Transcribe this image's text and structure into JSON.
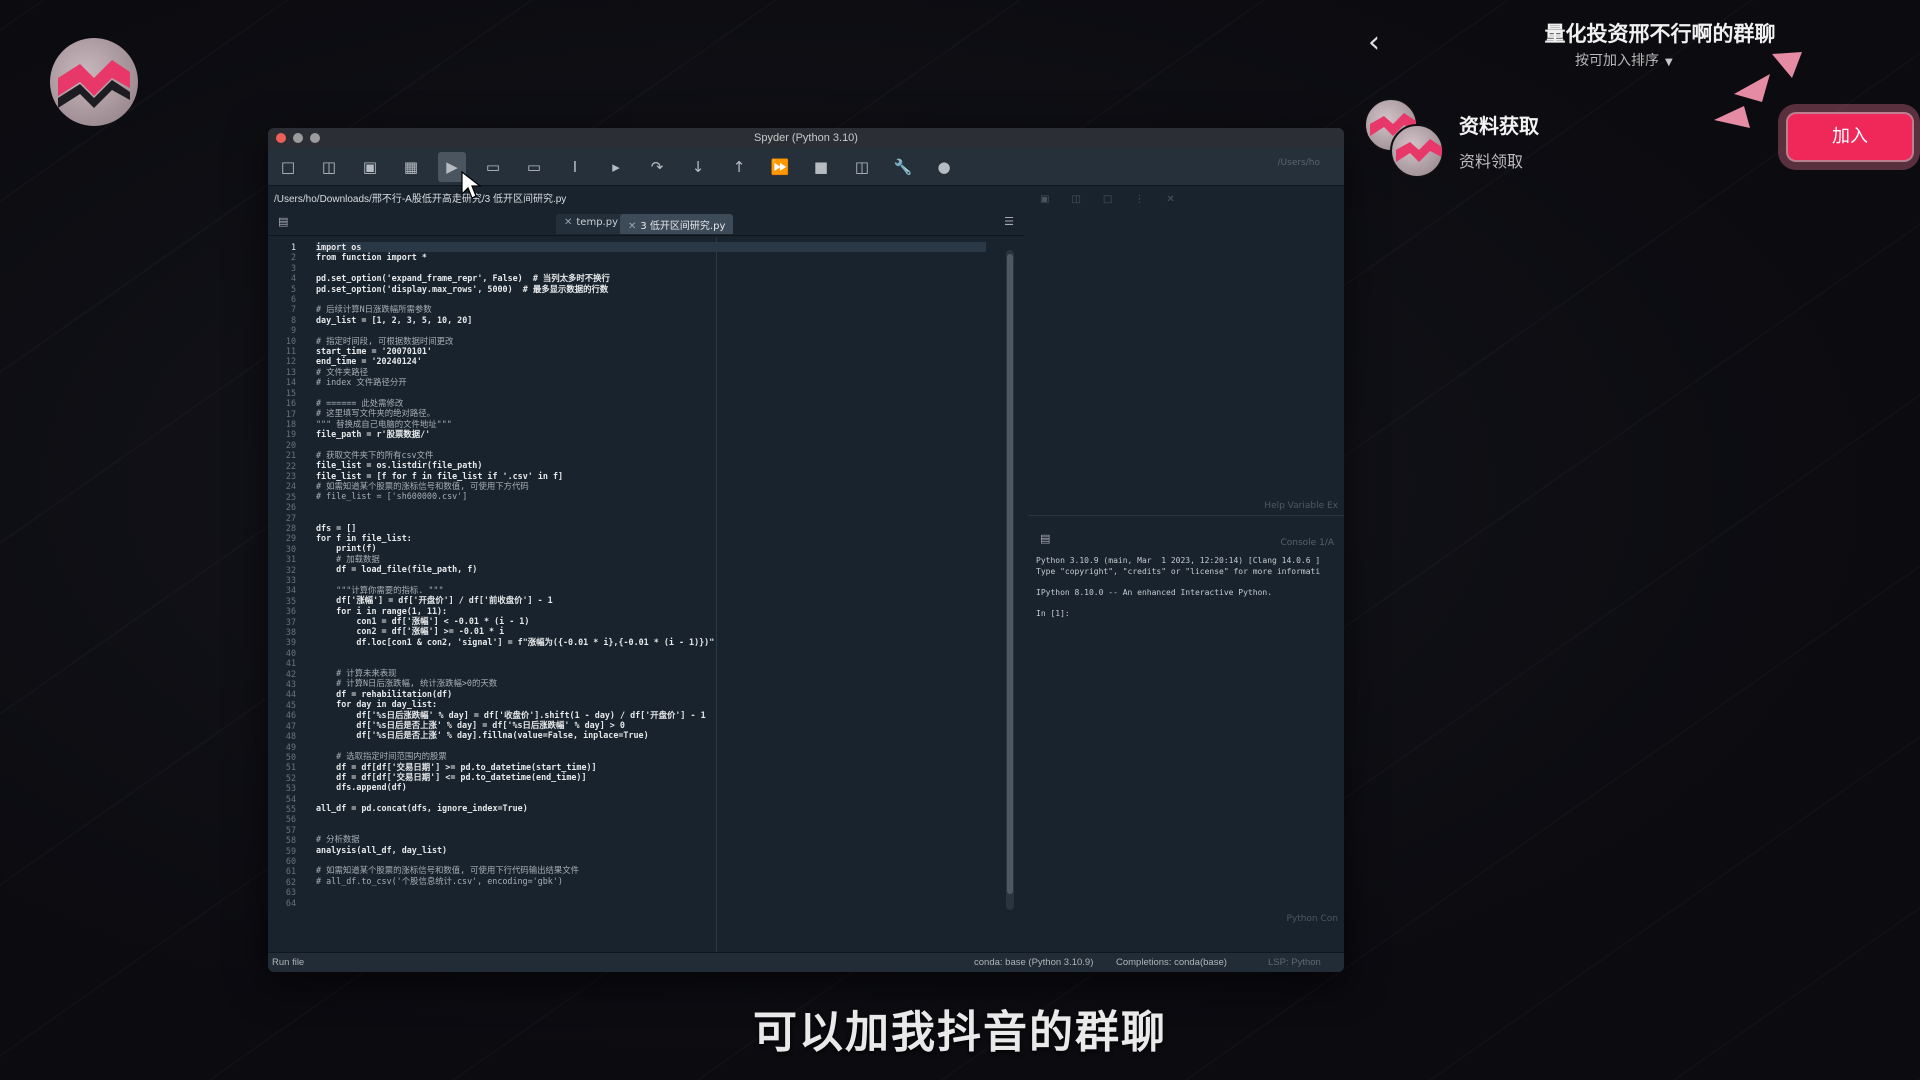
{
  "window": {
    "title": "Spyder (Python 3.10)",
    "path": "/Users/ho/Downloads/邢不行-A股低开高走研究/3 低开区间研究.py",
    "toolbar_path": "/Users/ho"
  },
  "editor": {
    "tabs": [
      {
        "label": "temp.py"
      },
      {
        "label": "3 低开区间研究.py"
      }
    ],
    "line_numbers": [
      "1",
      "2",
      "3",
      "4",
      "5",
      "6",
      "7",
      "8",
      "9",
      "10",
      "11",
      "12",
      "13",
      "14",
      "15",
      "16",
      "17",
      "18",
      "19",
      "20",
      "21",
      "22",
      "23",
      "24",
      "25",
      "26",
      "27",
      "28",
      "29",
      "30",
      "31",
      "32",
      "33",
      "34",
      "35",
      "36",
      "37",
      "38",
      "39",
      "40",
      "41",
      "42",
      "43",
      "44",
      "45",
      "46",
      "47",
      "48",
      "49",
      "50",
      "51",
      "52",
      "53",
      "54",
      "55",
      "56",
      "57",
      "58",
      "59",
      "60",
      "61",
      "62",
      "63",
      "64"
    ],
    "lines": [
      "import os",
      "from function import *",
      "",
      "pd.set_option('expand_frame_repr', False)  # 当列太多时不换行",
      "pd.set_option('display.max_rows', 5000)  # 最多显示数据的行数",
      "",
      "# 后续计算N日涨跌幅所需参数",
      "day_list = [1, 2, 3, 5, 10, 20]",
      "",
      "# 指定时间段, 可根据数据时间更改",
      "start_time = '20070101'",
      "end_time = '20240124'",
      "# 文件夹路径",
      "# index 文件路径分开",
      "",
      "# ====== 此处需修改",
      "# 这里填写文件夹的绝对路径。",
      "\"\"\" 替换成自己电脑的文件地址\"\"\"",
      "file_path = r'股票数据/'",
      "",
      "# 获取文件夹下的所有csv文件",
      "file_list = os.listdir(file_path)",
      "file_list = [f for f in file_list if '.csv' in f]",
      "# 如需知道某个股票的涨标信号和数值, 可使用下方代码",
      "# file_list = ['sh600000.csv']",
      "",
      "",
      "dfs = []",
      "for f in file_list:",
      "    print(f)",
      "    # 加载数据",
      "    df = load_file(file_path, f)",
      "",
      "    \"\"\"计算你需要的指标. \"\"\"",
      "    df['涨幅'] = df['开盘价'] / df['前收盘价'] - 1",
      "    for i in range(1, 11):",
      "        con1 = df['涨幅'] < -0.01 * (i - 1)",
      "        con2 = df['涨幅'] >= -0.01 * i",
      "        df.loc[con1 & con2, 'signal'] = f\"涨幅为({-0.01 * i},{-0.01 * (i - 1)})\"",
      "",
      "",
      "    # 计算未来表现",
      "    # 计算N日后涨跌幅, 统计涨跌幅>0的天数",
      "    df = rehabilitation(df)",
      "    for day in day_list:",
      "        df['%s日后涨跌幅' % day] = df['收盘价'].shift(1 - day) / df['开盘价'] - 1",
      "        df['%s日后是否上涨' % day] = df['%s日后涨跌幅' % day] > 0",
      "        df['%s日后是否上涨' % day].fillna(value=False, inplace=True)",
      "",
      "    # 选取指定时间范围内的股票",
      "    df = df[df['交易日期'] >= pd.to_datetime(start_time)]",
      "    df = df[df['交易日期'] <= pd.to_datetime(end_time)]",
      "    dfs.append(df)",
      "",
      "all_df = pd.concat(dfs, ignore_index=True)",
      "",
      "",
      "# 分析数据",
      "analysis(all_df, day_list)",
      "",
      "# 如需知道某个股票的涨标信号和数值, 可使用下行代码输出结果文件",
      "# all_df.to_csv('个股信息统计.csv', encoding='gbk')",
      "",
      ""
    ]
  },
  "help_pane": {
    "tabs": "Help  Variable Ex"
  },
  "console": {
    "tab": "Console 1/A",
    "line1": "Python 3.10.9 (main, Mar  1 2023, 12:20:14) [Clang 14.0.6 ]",
    "line2": "Type \"copyright\", \"credits\" or \"license\" for more informati",
    "line3": "IPython 8.10.0 -- An enhanced Interactive Python.",
    "prompt": "In [1]:",
    "bottom_tab": "Python Con"
  },
  "statusbar": {
    "left": "Run file",
    "env": "conda: base (Python 3.10.9)",
    "completions": "Completions: conda(base)",
    "lsp": "LSP: Python"
  },
  "group": {
    "title": "量化投资邢不行啊的群聊",
    "sort": "按可加入排序",
    "resource_title": "资料获取",
    "resource_sub": "资料领取",
    "join_label": "加入"
  },
  "caption": "可以加我抖音的群聊",
  "icons": {
    "back": "chevron-left-icon",
    "sort_caret": "caret-down-icon"
  },
  "colors": {
    "join_button": "#f0285a",
    "spyder_bg": "#19232d"
  }
}
